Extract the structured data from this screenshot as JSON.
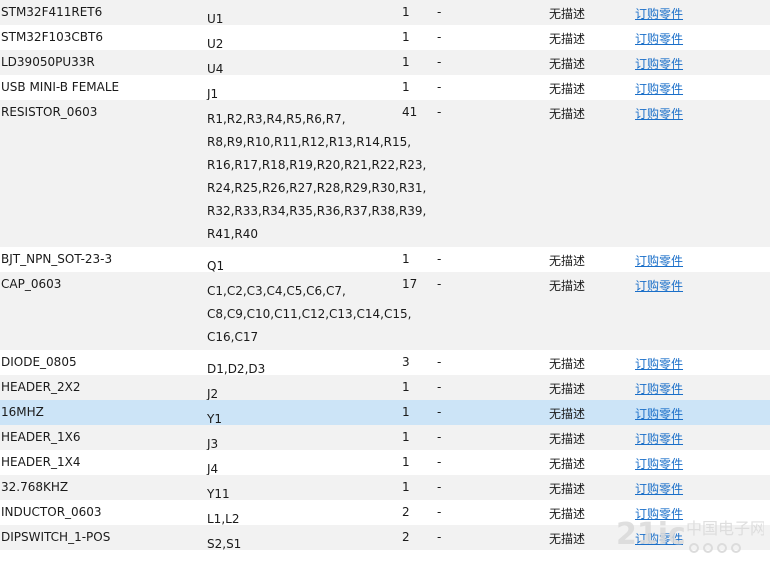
{
  "table": {
    "order_link_text": "订购零件",
    "dash": "-",
    "rows": [
      {
        "part": "STM32F411RET6",
        "refs": "U1",
        "qty": "1",
        "desc": "无描述"
      },
      {
        "part": "STM32F103CBT6",
        "refs": "U2",
        "qty": "1",
        "desc": "无描述"
      },
      {
        "part": "LD39050PU33R",
        "refs": "U4",
        "qty": "1",
        "desc": "无描述"
      },
      {
        "part": "USB MINI-B FEMALE",
        "refs": "J1",
        "qty": "1",
        "desc": "无描述"
      },
      {
        "part": "RESISTOR_0603",
        "refs": "R1,R2,R3,R4,R5,R6,R7, R8,R9,R10,R11,R12,R13,R14,R15, R16,R17,R18,R19,R20,R21,R22,R23, R24,R25,R26,R27,R28,R29,R30,R31, R32,R33,R34,R35,R36,R37,R38,R39, R41,R40",
        "qty": "41",
        "desc": "无描述"
      },
      {
        "part": "BJT_NPN_SOT-23-3",
        "refs": "Q1",
        "qty": "1",
        "desc": "无描述"
      },
      {
        "part": "CAP_0603",
        "refs": "C1,C2,C3,C4,C5,C6,C7, C8,C9,C10,C11,C12,C13,C14,C15, C16,C17",
        "qty": "17",
        "desc": "无描述"
      },
      {
        "part": "DIODE_0805",
        "refs": "D1,D2,D3",
        "qty": "3",
        "desc": "无描述"
      },
      {
        "part": "HEADER_2X2",
        "refs": "J2",
        "qty": "1",
        "desc": "无描述"
      },
      {
        "part": "16MHZ",
        "refs": "Y1",
        "qty": "1",
        "desc": "无描述",
        "selected": true
      },
      {
        "part": "HEADER_1X6",
        "refs": "J3",
        "qty": "1",
        "desc": "无描述"
      },
      {
        "part": "HEADER_1X4",
        "refs": "J4",
        "qty": "1",
        "desc": "无描述"
      },
      {
        "part": "32.768KHZ",
        "refs": "Y11",
        "qty": "1",
        "desc": "无描述"
      },
      {
        "part": "INDUCTOR_0603",
        "refs": "L1,L2",
        "qty": "2",
        "desc": "无描述"
      },
      {
        "part": "DIPSWITCH_1-POS",
        "refs": "S2,S1",
        "qty": "2",
        "desc": "无描述"
      }
    ]
  },
  "watermark": {
    "logo": "21ic",
    "site_name": "中国电子网"
  },
  "colors": {
    "link": "#1a6fc9",
    "row_alt": "#f2f2f2",
    "row_selected": "#cce4f7"
  }
}
